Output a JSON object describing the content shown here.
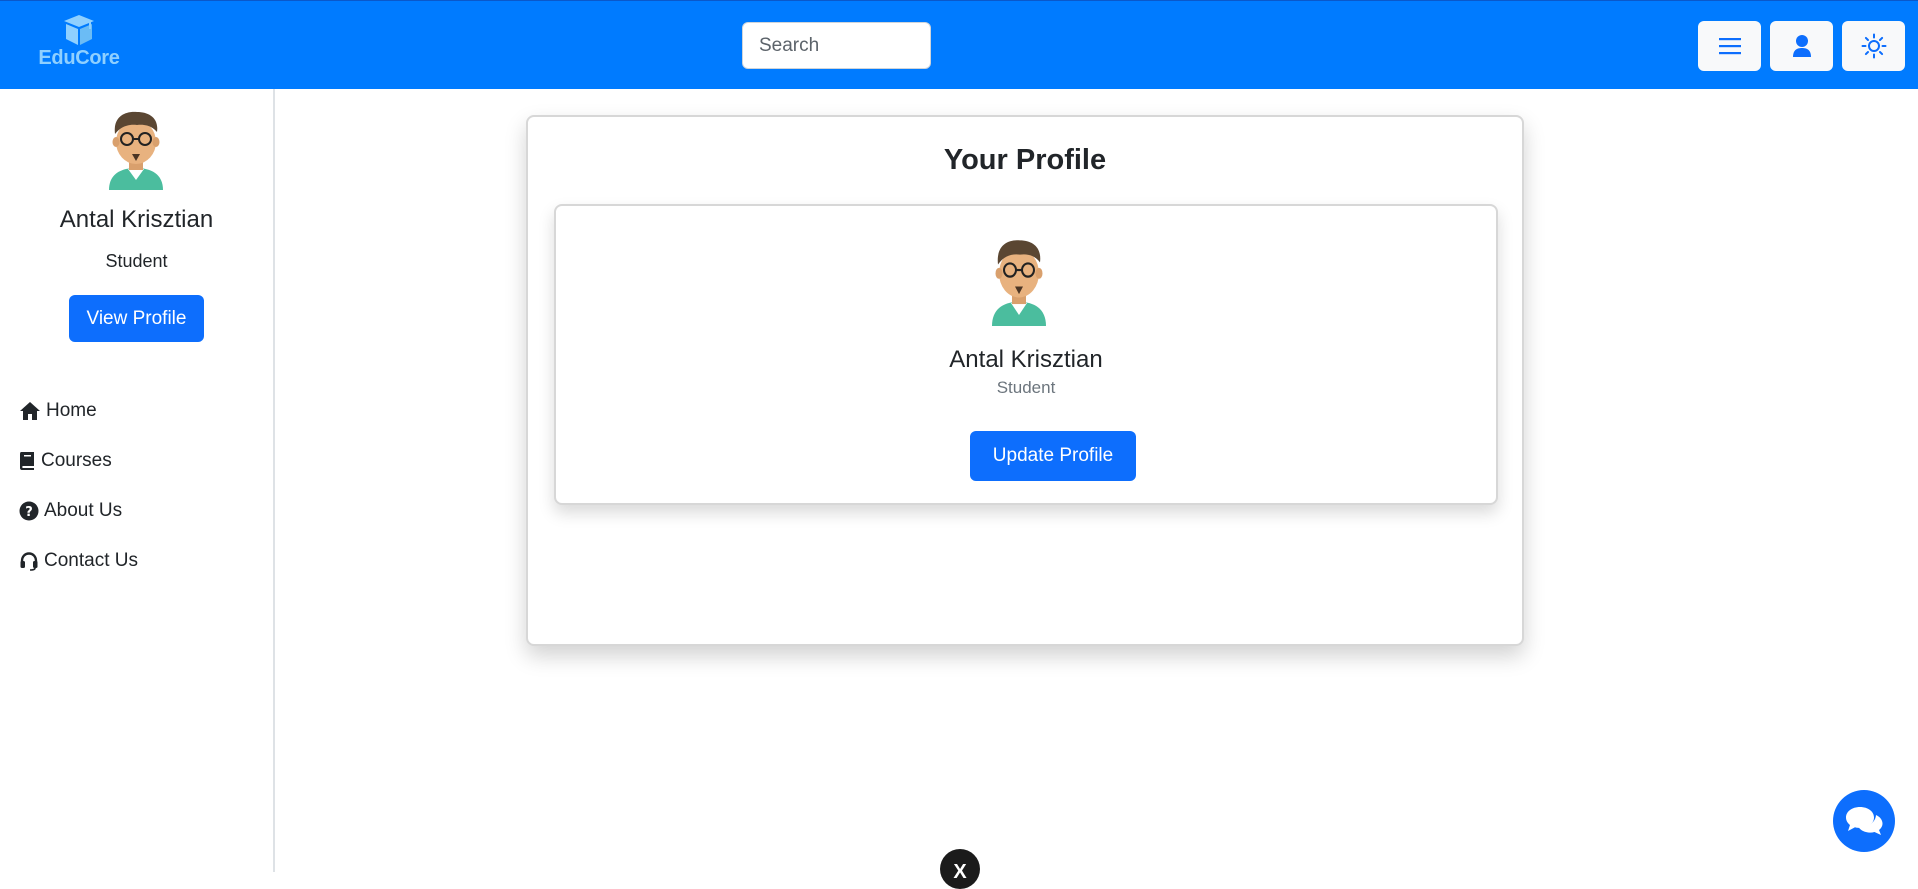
{
  "brand": {
    "name": "EduCore",
    "logo_icon": "graduation-box-icon",
    "color": "#8fd0ff"
  },
  "header": {
    "search_placeholder": "Search",
    "menu_icon": "hamburger-menu-icon",
    "user_icon": "user-icon",
    "theme_icon": "sun-icon",
    "accent": "#007bff"
  },
  "sidebar": {
    "user_name": "Antal Krisztian",
    "user_role": "Student",
    "view_profile_label": "View Profile",
    "items": [
      {
        "label": "Home",
        "icon": "home-icon"
      },
      {
        "label": "Courses",
        "icon": "book-icon"
      },
      {
        "label": "About Us",
        "icon": "question-circle-icon"
      },
      {
        "label": "Contact Us",
        "icon": "headset-icon"
      }
    ]
  },
  "main": {
    "title": "Your Profile",
    "profile": {
      "name": "Antal Krisztian",
      "role": "Student",
      "update_label": "Update Profile"
    }
  },
  "floating": {
    "chat_icon": "chat-bubbles-icon",
    "close_label": "X"
  }
}
